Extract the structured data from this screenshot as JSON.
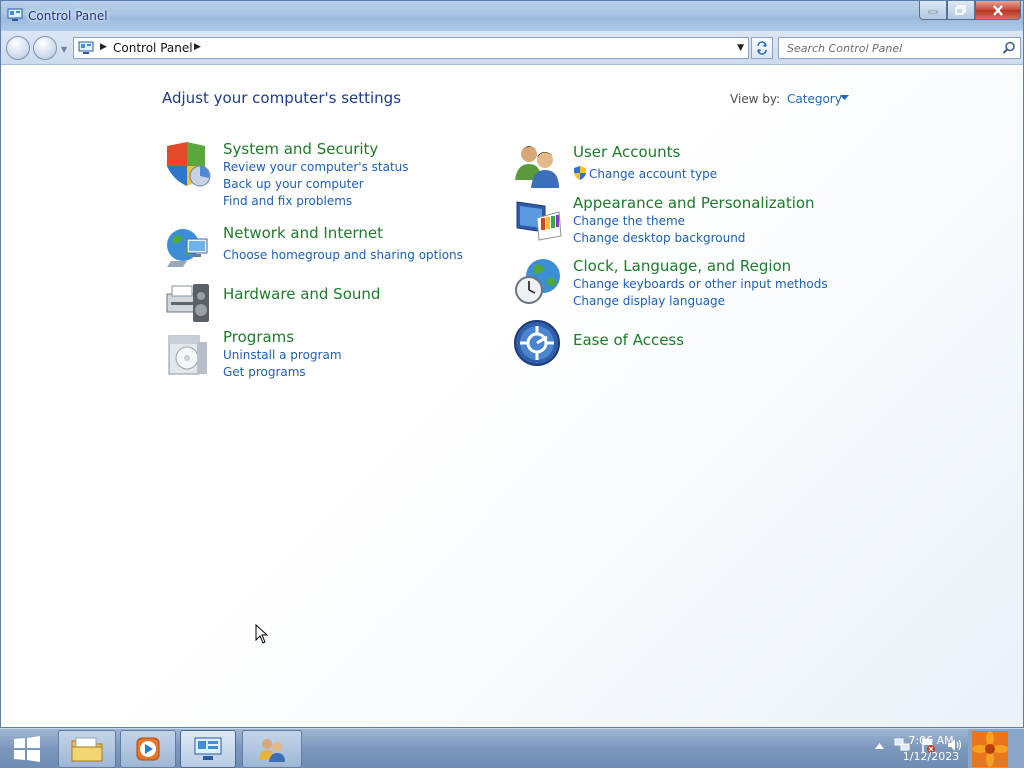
{
  "window": {
    "title": "Control Panel"
  },
  "address": {
    "path": "Control Panel"
  },
  "search": {
    "placeholder": "Search Control Panel"
  },
  "header": {
    "title": "Adjust your computer's settings",
    "view_by_label": "View by:",
    "view_by_value": "Category"
  },
  "categories": {
    "system_security": {
      "title": "System and Security",
      "links": [
        "Review your computer's status",
        "Back up your computer",
        "Find and fix problems"
      ]
    },
    "network": {
      "title": "Network and Internet",
      "links": [
        "Choose homegroup and sharing options"
      ]
    },
    "hardware": {
      "title": "Hardware and Sound",
      "links": []
    },
    "programs": {
      "title": "Programs",
      "links": [
        "Uninstall a program",
        "Get programs"
      ]
    },
    "user_accounts": {
      "title": "User Accounts",
      "links": [
        "Change account type"
      ]
    },
    "appearance": {
      "title": "Appearance and Personalization",
      "links": [
        "Change the theme",
        "Change desktop background"
      ]
    },
    "clock": {
      "title": "Clock, Language, and Region",
      "links": [
        "Change keyboards or other input methods",
        "Change display language"
      ]
    },
    "ease": {
      "title": "Ease of Access",
      "links": []
    }
  },
  "taskbar": {
    "time": "7:06 AM",
    "date": "1/12/2023"
  },
  "colors": {
    "title_blue": "#1e3b8a",
    "category_green": "#1f7a2a",
    "link_blue": "#1e5fb4"
  }
}
